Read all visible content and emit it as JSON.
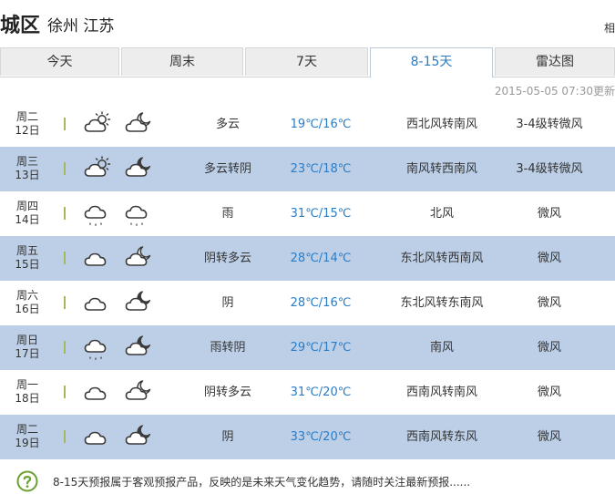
{
  "header": {
    "district": "城区",
    "city": "徐州  江苏",
    "corner": "相"
  },
  "tabs": [
    {
      "label": "今天",
      "active": false
    },
    {
      "label": "周末",
      "active": false
    },
    {
      "label": "7天",
      "active": false
    },
    {
      "label": "8-15天",
      "active": true
    },
    {
      "label": "雷达图",
      "active": false
    }
  ],
  "update_time": "2015-05-05 07:30更新",
  "forecast": [
    {
      "weekday": "周二",
      "date": "12日",
      "day_icon": "partly-cloudy-sun-icon",
      "night_icon": "partly-cloudy-moon-icon",
      "desc": "多云",
      "temp": "19℃/16℃",
      "wind": "西北风转南风",
      "level": "3-4级转微风"
    },
    {
      "weekday": "周三",
      "date": "13日",
      "day_icon": "partly-cloudy-sun-icon",
      "night_icon": "overcast-moon-icon",
      "desc": "多云转阴",
      "temp": "23℃/18℃",
      "wind": "南风转西南风",
      "level": "3-4级转微风"
    },
    {
      "weekday": "周四",
      "date": "14日",
      "day_icon": "rain-icon",
      "night_icon": "rain-icon",
      "desc": "雨",
      "temp": "31℃/15℃",
      "wind": "北风",
      "level": "微风"
    },
    {
      "weekday": "周五",
      "date": "15日",
      "day_icon": "overcast-icon",
      "night_icon": "partly-cloudy-moon-icon",
      "desc": "阴转多云",
      "temp": "28℃/14℃",
      "wind": "东北风转西南风",
      "level": "微风"
    },
    {
      "weekday": "周六",
      "date": "16日",
      "day_icon": "overcast-icon",
      "night_icon": "overcast-moon-icon",
      "desc": "阴",
      "temp": "28℃/16℃",
      "wind": "东北风转东南风",
      "level": "微风"
    },
    {
      "weekday": "周日",
      "date": "17日",
      "day_icon": "rain-icon",
      "night_icon": "overcast-moon-icon",
      "desc": "雨转阴",
      "temp": "29℃/17℃",
      "wind": "南风",
      "level": "微风"
    },
    {
      "weekday": "周一",
      "date": "18日",
      "day_icon": "overcast-icon",
      "night_icon": "partly-cloudy-moon-icon",
      "desc": "阴转多云",
      "temp": "31℃/20℃",
      "wind": "西南风转南风",
      "level": "微风"
    },
    {
      "weekday": "周二",
      "date": "19日",
      "day_icon": "overcast-icon",
      "night_icon": "overcast-moon-icon",
      "desc": "阴",
      "temp": "33℃/20℃",
      "wind": "西南风转东风",
      "level": "微风"
    }
  ],
  "footer": {
    "icon": "help-question-icon",
    "note": "8-15天预报属于客观预报产品，反映的是未来天气变化趋势，请随时关注最新预报......"
  },
  "colors": {
    "accent": "#2a7cc7",
    "alt_row": "#bccfe7",
    "separator": "#a5b85b",
    "help_icon": "#6aa12f"
  }
}
